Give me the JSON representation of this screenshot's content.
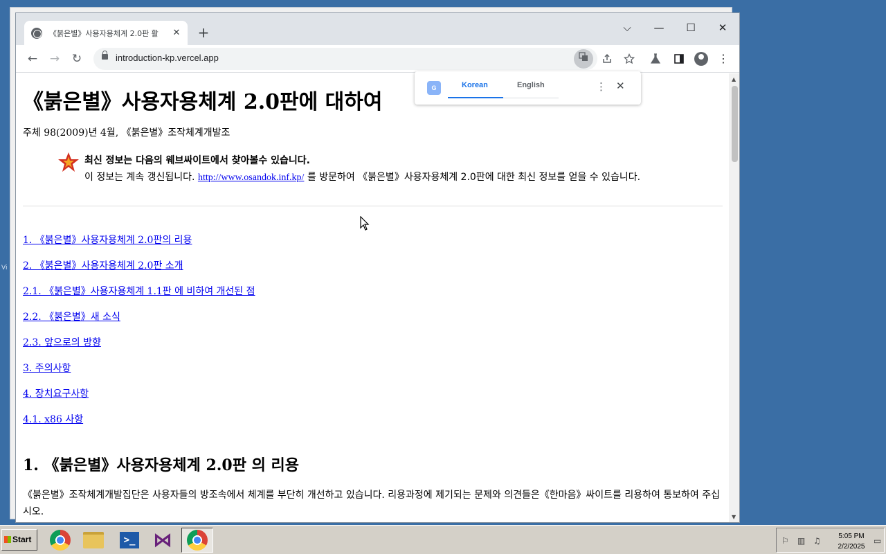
{
  "desktop": {
    "edge_label": "Vi"
  },
  "browser": {
    "tab": {
      "title": "《붉은별》사용자용체계 2.0판 활",
      "close_glyph": "✕"
    },
    "new_tab_glyph": "+",
    "window_controls": {
      "dropdown": "⌵",
      "minimize": "—",
      "maximize": "☐",
      "close": "✕"
    },
    "toolbar": {
      "back": "←",
      "forward": "→",
      "reload": "↻",
      "url": "introduction-kp.vercel.app"
    },
    "icons": [
      "back-icon",
      "forward-icon",
      "reload-icon",
      "lock-icon",
      "translate-icon",
      "share-icon",
      "star-icon",
      "labs-icon",
      "side-panel-icon",
      "profile-icon",
      "menu-icon"
    ]
  },
  "translate_popup": {
    "logo": "G",
    "languages": [
      "Korean",
      "English"
    ],
    "selected": "Korean",
    "menu_glyph": "⋮",
    "close_glyph": "✕"
  },
  "page": {
    "title": "《붉은별》사용자용체계 2.0판에 대하여",
    "byline": "주체 98(2009)년 4월, 《붉은별》조작체계개발조",
    "notice": {
      "title": "최신 정보는 다음의 웨브싸이트에서 찾아볼수 있습니다.",
      "body_before": "이 정보는 계속 갱신됩니다.  ",
      "link": "http://www.osandok.inf.kp/",
      "body_after": " 를 방문하여 《붉은별》사용자용체계 2.0판에 대한 최신 정보를 얻을 수 있습니다."
    },
    "toc": [
      "1. 《붉은별》사용자용체계 2.0판의 리용",
      "2. 《붉은별》사용자용체계 2.0판 소개",
      "2.1. 《붉은별》사용자용체계 1.1판 에 비하여 개선된 점",
      "2.2. 《붉은별》새 소식",
      "2.3. 앞으로의 방향",
      "3. 주의사항",
      "4. 장치요구사항",
      "4.1. x86 사항"
    ],
    "section1_heading": "1. 《붉은별》사용자용체계 2.0판 의 리용",
    "section1_text": "《붉은별》조작체계개발집단은 사용자들의 방조속에서 체계를 부단히 개선하고 있습니다. 리용과정에 제기되는 문제와 의견들은《한마음》싸이트를 리용하여 통보하여 주십시오."
  },
  "taskbar": {
    "start_label": "Start",
    "apps": [
      "chrome-app",
      "file-explorer-app",
      "powershell-app",
      "visual-studio-app",
      "chrome-app-active"
    ],
    "powershell_glyph": ">_",
    "vs_glyph": "⋈",
    "clock": {
      "time": "5:05 PM",
      "date": "2/2/2025"
    },
    "tray_icons": [
      "flag-icon",
      "network-icon",
      "volume-icon",
      "show-desktop-icon"
    ]
  },
  "colors": {
    "desktop": "#3a6ea5",
    "link": "#0000ee",
    "translate_accent": "#1a73e8",
    "taskbar": "#d4d0c8"
  }
}
